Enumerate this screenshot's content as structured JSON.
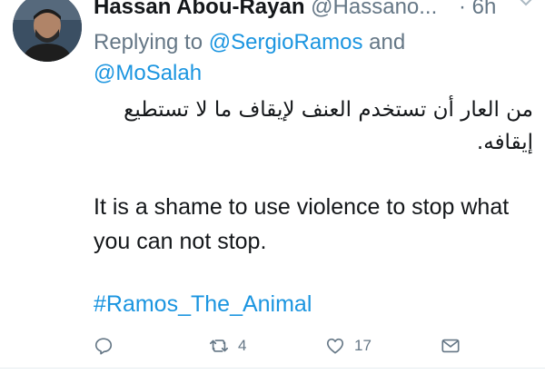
{
  "tweet": {
    "author_name": "Hassan Abou-Rayan",
    "author_handle": "@Hassano...",
    "time": "· 6h",
    "replying_prefix": "Replying to ",
    "mention_1": "@SergioRamos",
    "replying_and": " and",
    "mention_2": "@MoSalah",
    "text_arabic": "من العار أن تستخدم العنف لإيقاف ما لا تستطيع إيقافه.",
    "text_english": "It is a shame to use violence to stop what you can not stop.",
    "hashtag": "#Ramos_The_Animal"
  },
  "actions": {
    "reply": {
      "icon": "reply-icon",
      "count": ""
    },
    "retweet": {
      "icon": "retweet-icon",
      "count": "4"
    },
    "like": {
      "icon": "heart-icon",
      "count": "17"
    },
    "dm": {
      "icon": "envelope-icon",
      "count": ""
    }
  },
  "colors": {
    "text": "#14171a",
    "muted": "#657786",
    "link": "#1b95e0"
  }
}
